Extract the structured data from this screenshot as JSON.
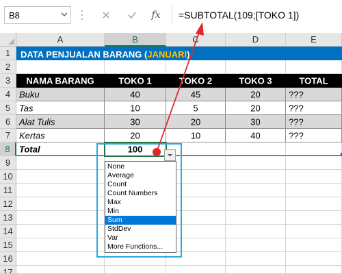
{
  "formula_bar": {
    "name_box": "B8",
    "formula": "=SUBTOTAL(109;[TOKO 1])",
    "cancel_icon": "cancel-icon",
    "enter_icon": "enter-icon",
    "fx_label": "fx"
  },
  "columns": [
    "A",
    "B",
    "C",
    "D",
    "E"
  ],
  "rows": [
    "1",
    "2",
    "3",
    "4",
    "5",
    "6",
    "7",
    "8",
    "9",
    "10",
    "11",
    "12",
    "13",
    "14",
    "15",
    "16",
    "17"
  ],
  "sheet": {
    "title_main": "DATA PENJUALAN BARANG (",
    "title_month": "JANUARI",
    "title_close": ")",
    "headers": [
      "NAMA BARANG",
      "TOKO 1",
      "TOKO 2",
      "TOKO 3",
      "TOTAL"
    ],
    "data": [
      {
        "name": "Buku",
        "toko1": "40",
        "toko2": "45",
        "toko3": "20",
        "total": "???"
      },
      {
        "name": "Tas",
        "toko1": "10",
        "toko2": "5",
        "toko3": "20",
        "total": "???"
      },
      {
        "name": "Alat Tulis",
        "toko1": "30",
        "toko2": "20",
        "toko3": "30",
        "total": "???"
      },
      {
        "name": "Kertas",
        "toko1": "20",
        "toko2": "10",
        "toko3": "40",
        "total": "???"
      }
    ],
    "total_label": "Total",
    "total_value": "100"
  },
  "dropdown": {
    "options": [
      "None",
      "Average",
      "Count",
      "Count Numbers",
      "Max",
      "Min",
      "Sum",
      "StdDev",
      "Var",
      "More Functions..."
    ],
    "selected": "Sum"
  },
  "colors": {
    "title_bg": "#0070c0",
    "title_highlight": "#ffc000",
    "header_bg": "#000000",
    "band_bg": "#d9d9d9",
    "selection": "#217346",
    "callout": "#29a8e0",
    "arrow": "#e0282c",
    "dropdown_highlight": "#0078d7"
  }
}
